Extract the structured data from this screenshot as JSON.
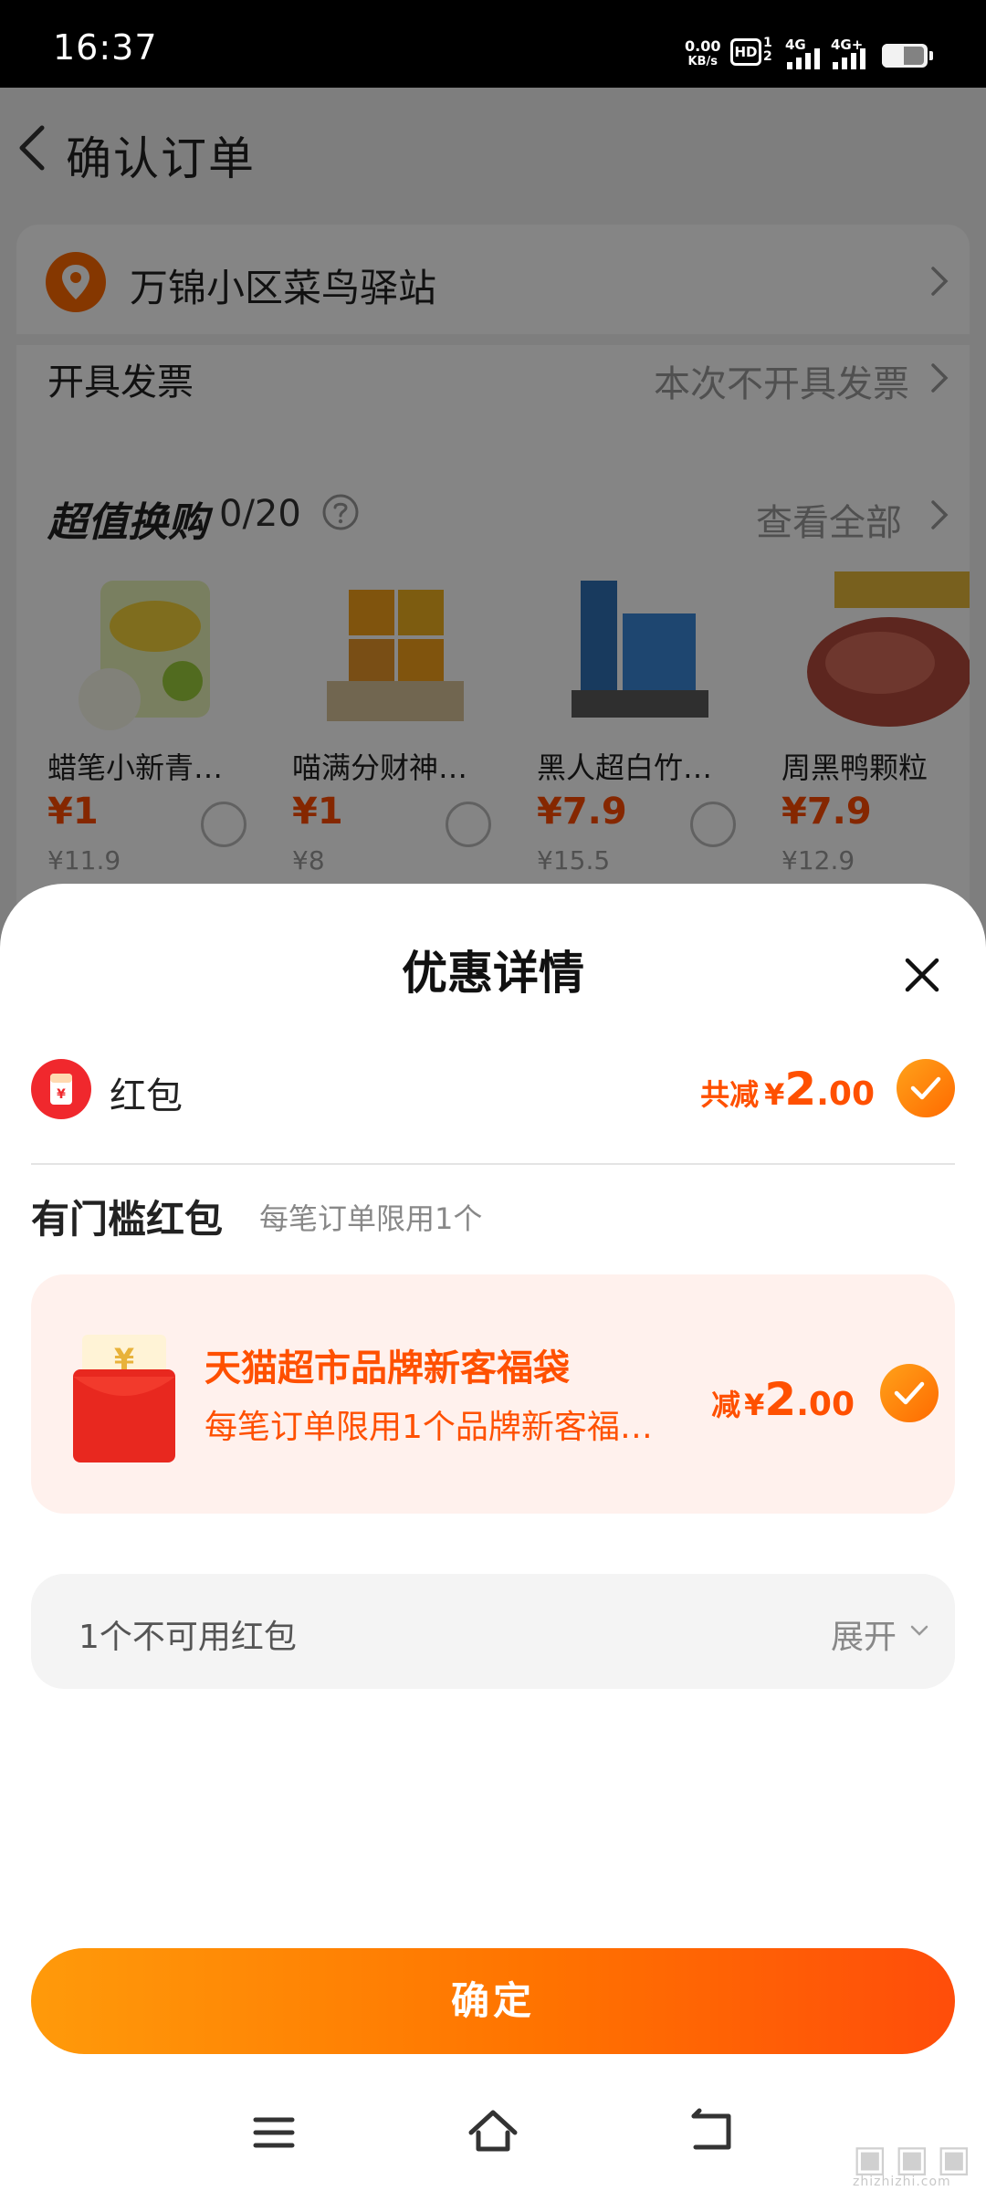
{
  "status_bar": {
    "time": "16:37",
    "net_speed_value": "0.00",
    "net_speed_unit": "KB/s",
    "hd_label": "HD",
    "sim_numbers": [
      "1",
      "2"
    ],
    "signal_1": "4G",
    "signal_2": "4G+",
    "battery_icon": "battery-icon"
  },
  "page": {
    "title": "确认订单",
    "back_icon": "chevron-left-icon",
    "address": "万锦小区菜鸟驿站",
    "invoice_label": "开具发票",
    "invoice_value": "本次不开具发票",
    "deals": {
      "title": "超值换购",
      "count": "0/20",
      "view_all": "查看全部",
      "products": [
        {
          "name": "蜡笔小新青…",
          "price": "¥1",
          "orig": "¥11.9"
        },
        {
          "name": "喵满分财神…",
          "price": "¥1",
          "orig": "¥8"
        },
        {
          "name": "黑人超白竹…",
          "price": "¥7.9",
          "orig": "¥15.5"
        },
        {
          "name": "周黑鸭颗粒",
          "price": "¥7.9",
          "orig": "¥12.9"
        }
      ]
    }
  },
  "sheet": {
    "title": "优惠详情",
    "red_packet": {
      "label": "红包",
      "total_prefix": "共减",
      "yen": "¥",
      "amount_int": "2",
      "amount_dec": ".00",
      "checked": true
    },
    "threshold": {
      "title": "有门槛红包",
      "subtitle": "每笔订单限用1个"
    },
    "coupon": {
      "title": "天猫超市品牌新客福袋",
      "desc": "每笔订单限用1个品牌新客福…",
      "prefix": "减",
      "yen": "¥",
      "amount_int": "2",
      "amount_dec": ".00",
      "checked": true
    },
    "unavailable": {
      "label": "1个不可用红包",
      "expand": "展开"
    },
    "confirm": "确定"
  },
  "watermark": {
    "text": "zhizhizhi.com"
  },
  "colors": {
    "accent": "#ff5000",
    "check_gradient_start": "#ffa21a",
    "check_gradient_end": "#ff6a00",
    "coupon_bg": "#fff1ed"
  }
}
